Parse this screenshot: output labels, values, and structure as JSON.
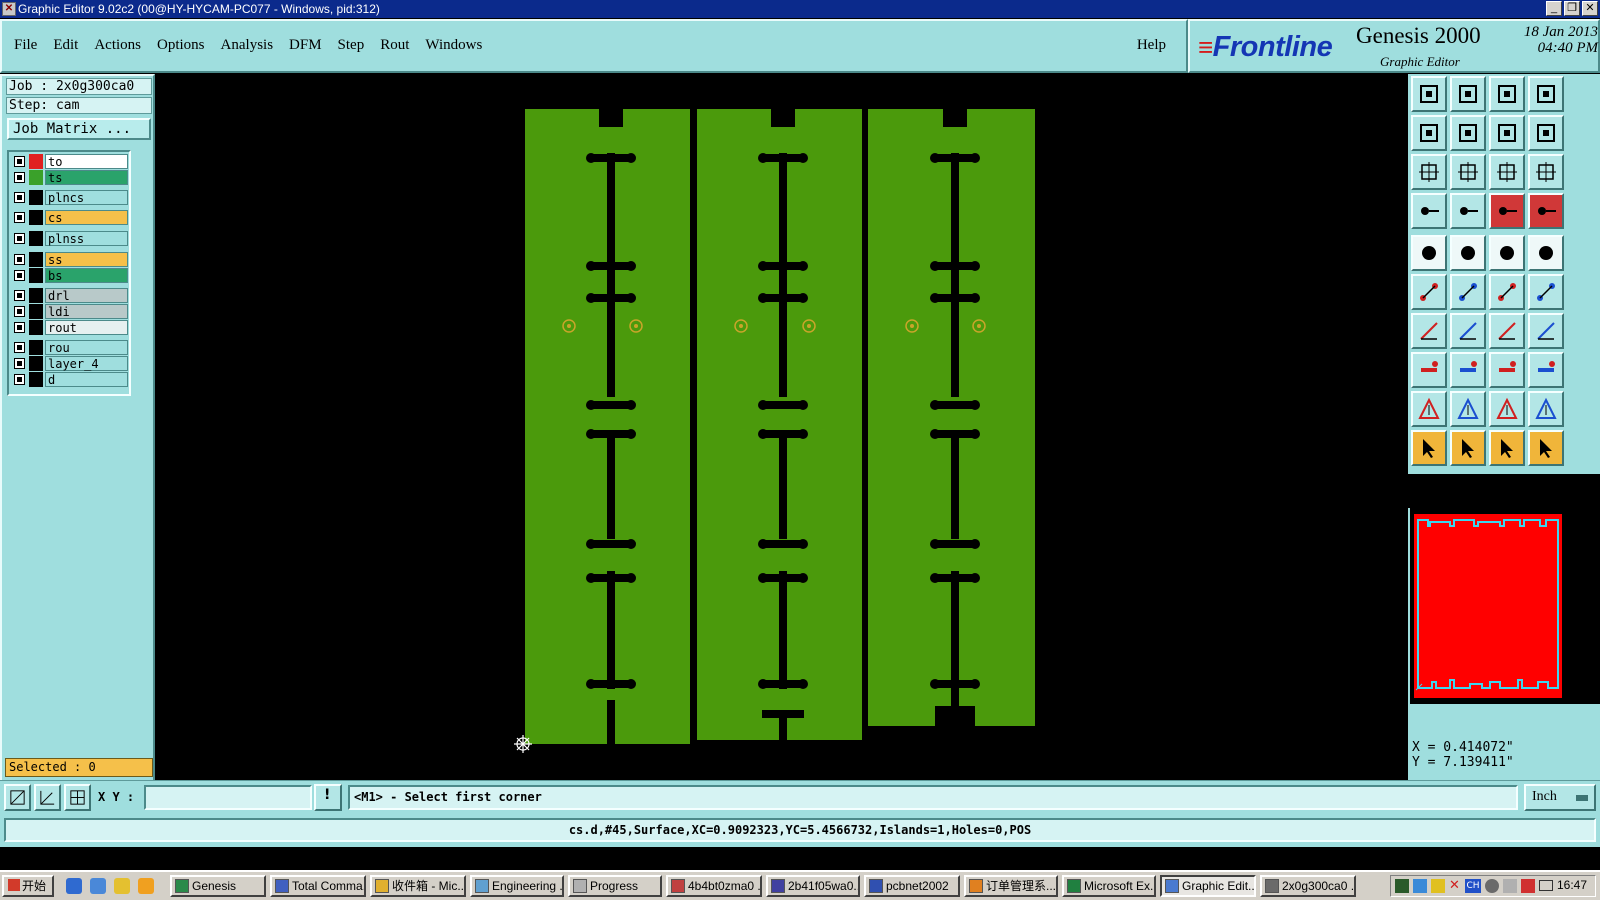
{
  "window": {
    "title": "Graphic Editor 9.02c2 (00@HY-HYCAM-PC077 - Windows, pid:312)",
    "buttons": [
      "_",
      "❐",
      "✕"
    ]
  },
  "menu": {
    "items": [
      "File",
      "Edit",
      "Actions",
      "Options",
      "Analysis",
      "DFM",
      "Step",
      "Rout",
      "Windows"
    ],
    "help": "Help"
  },
  "brand": {
    "logo": "Frontline",
    "product": "Genesis 2000",
    "subtitle": "Graphic Editor",
    "date": "18 Jan 2013",
    "time": "04:40 PM"
  },
  "left_panel": {
    "job": "Job : 2x0g300ca0",
    "step": "Step: cam",
    "job_matrix": "Job Matrix ...",
    "selected": "Selected : 0"
  },
  "layers": [
    {
      "name": "to",
      "color": "#ffffff",
      "swatch": "#e02020"
    },
    {
      "name": "ts",
      "color": "#2aa36b",
      "swatch": "#3aa12a"
    },
    {
      "name": "plncs",
      "color": "#9fdede",
      "swatch": "#000000"
    },
    {
      "name": "cs",
      "color": "#f5c04a",
      "swatch": "#000000"
    },
    {
      "name": "plnss",
      "color": "#9fdede",
      "swatch": "#000000"
    },
    {
      "name": "ss",
      "color": "#f5c04a",
      "swatch": "#000000"
    },
    {
      "name": "bs",
      "color": "#2aa36b",
      "swatch": "#000000"
    },
    {
      "name": "drl",
      "color": "#b8c9c9",
      "swatch": "#000000"
    },
    {
      "name": "ldi",
      "color": "#b8c9c9",
      "swatch": "#000000"
    },
    {
      "name": "rout",
      "color": "#e6f0f0",
      "swatch": "#000000"
    },
    {
      "name": "rou",
      "color": "#9fdede",
      "swatch": "#000000"
    },
    {
      "name": "layer_4",
      "color": "#9fdede",
      "swatch": "#000000"
    },
    {
      "name": "d",
      "color": "#9fdede",
      "swatch": "#000000"
    }
  ],
  "colors": {
    "board": "#4b9a0c",
    "pad": "#c9a52a",
    "minimap": "#ff0000",
    "minimap_outline": "#3bd6f0"
  },
  "coords": {
    "x": "X =  0.414072\"",
    "y": "Y =  7.139411\""
  },
  "command": {
    "xy_label": "X Y :",
    "xy_value": "",
    "bang": "!",
    "prompt": "<M1> - Select first corner",
    "unit": "Inch"
  },
  "status": "cs.d,#45,Surface,XC=0.9092323,YC=5.4566732,Islands=1,Holes=0,POS",
  "taskbar": {
    "start": "开始",
    "tasks": [
      "Genesis",
      "Total Comma...",
      "收件箱 - Mic...",
      "Engineering ...",
      "Progress",
      "4b4bt0zma0 ...",
      "2b41f05wa0...",
      "pcbnet2002",
      "订单管理系...",
      "Microsoft Ex...",
      "Graphic Edit...",
      "2x0g300ca0 ..."
    ],
    "tray_labels": [
      "CH"
    ],
    "clock": "16:47"
  }
}
